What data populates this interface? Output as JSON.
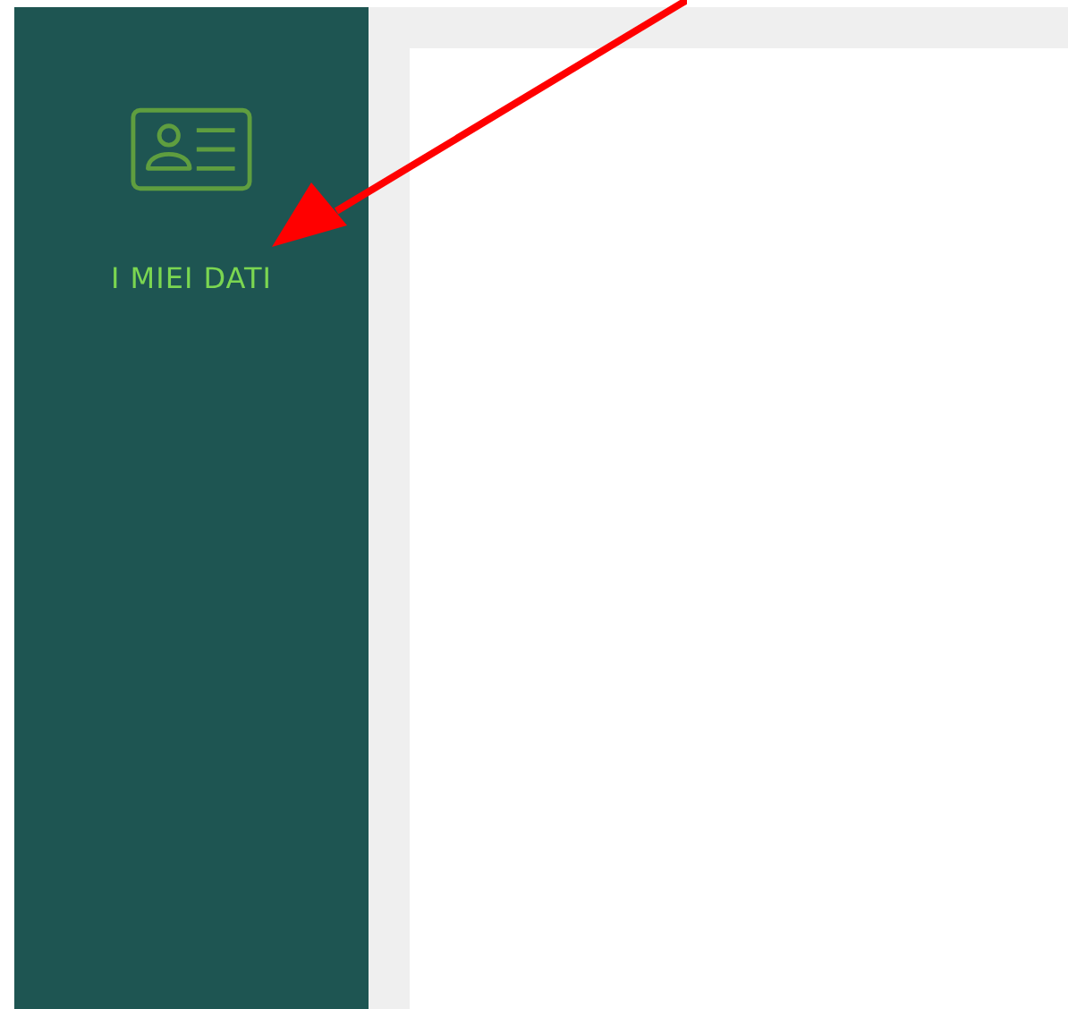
{
  "sidebar": {
    "items": [
      {
        "label": "I MIEI DATI"
      }
    ]
  }
}
